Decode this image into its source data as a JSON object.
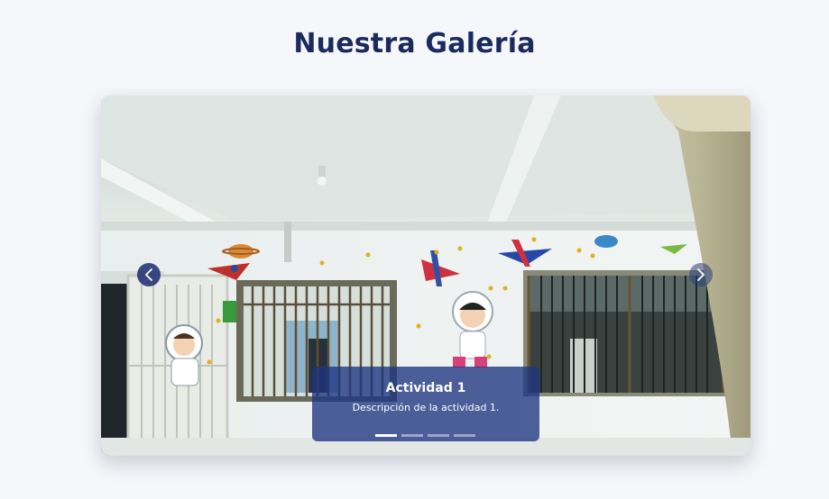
{
  "gallery": {
    "title": "Nuestra Galería",
    "slide": {
      "title": "Actividad 1",
      "description": "Descripción de la actividad 1."
    },
    "prev_icon": "chevron-left-icon",
    "next_icon": "chevron-right-icon",
    "slide_count": 4,
    "active_index": 0
  },
  "colors": {
    "title": "#1a2b5e",
    "caption_bg": "#1e3482",
    "nav_bg": "#1a2b6e",
    "page_bg": "#f6f7fa"
  }
}
